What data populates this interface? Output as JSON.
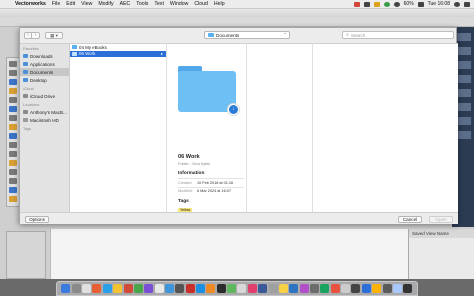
{
  "menubar": {
    "apple": "",
    "items": [
      "Vectorworks",
      "File",
      "Edit",
      "View",
      "Modify",
      "AEC",
      "Tools",
      "Text",
      "Window",
      "Cloud",
      "Help"
    ],
    "clock": "Tue 16:08",
    "battery": "60%"
  },
  "toolbar": {
    "back": "‹",
    "forward": "›",
    "view_mode": "▦ ▾",
    "location": "Documents",
    "search_placeholder": "Search"
  },
  "sidebar": {
    "favorites_heading": "Favorites",
    "favorites": [
      "Downloads",
      "Applications",
      "Documents",
      "Desktop"
    ],
    "icloud_heading": "iCloud",
    "icloud": [
      "iCloud Drive"
    ],
    "locations_heading": "Locations",
    "locations": [
      "Anthony's MacB...",
      "Macintosh HD"
    ],
    "tags_heading": "Tags"
  },
  "columns": {
    "col1": [
      "04 My eBooks",
      "06 Work"
    ]
  },
  "preview": {
    "name": "06 Work",
    "kind": "Folder - Zero bytes",
    "info_heading": "Information",
    "created_label": "Created",
    "created_value": "10 Feb 2018 at 01:16",
    "modified_label": "Modified",
    "modified_value": "6 Mar 2024 at 16:07",
    "tags_heading": "Tags",
    "tag": "Yellow"
  },
  "buttons": {
    "options": "Options",
    "cancel": "Cancel",
    "open": "Open"
  },
  "background": {
    "right_panel_label": "Saved View Name"
  },
  "colors": {
    "accent": "#2d6fd8",
    "folder": "#6ec0f4",
    "tag_yellow": "#f5e57a"
  },
  "dock_colors": [
    "#3b7be0",
    "#8a8a8a",
    "#e0e0e0",
    "#e95f35",
    "#2aa0e8",
    "#f2c230",
    "#d14a3a",
    "#4aa64a",
    "#7a4fd6",
    "#e8e8e8",
    "#3f95d9",
    "#555",
    "#c9302c",
    "#1d8fe0",
    "#f08a24",
    "#2c2c2c",
    "#5db75d",
    "#d8d8d8",
    "#e23f6e",
    "#3b5998",
    "#a0a0a0",
    "#f7d046",
    "#2f74c0",
    "#b04fc8",
    "#6c6c6c",
    "#1aa260",
    "#e8533f",
    "#cccccc",
    "#444",
    "#2d6fd8",
    "#ffb100",
    "#5a5a5a",
    "#a8c7fa",
    "#333"
  ]
}
